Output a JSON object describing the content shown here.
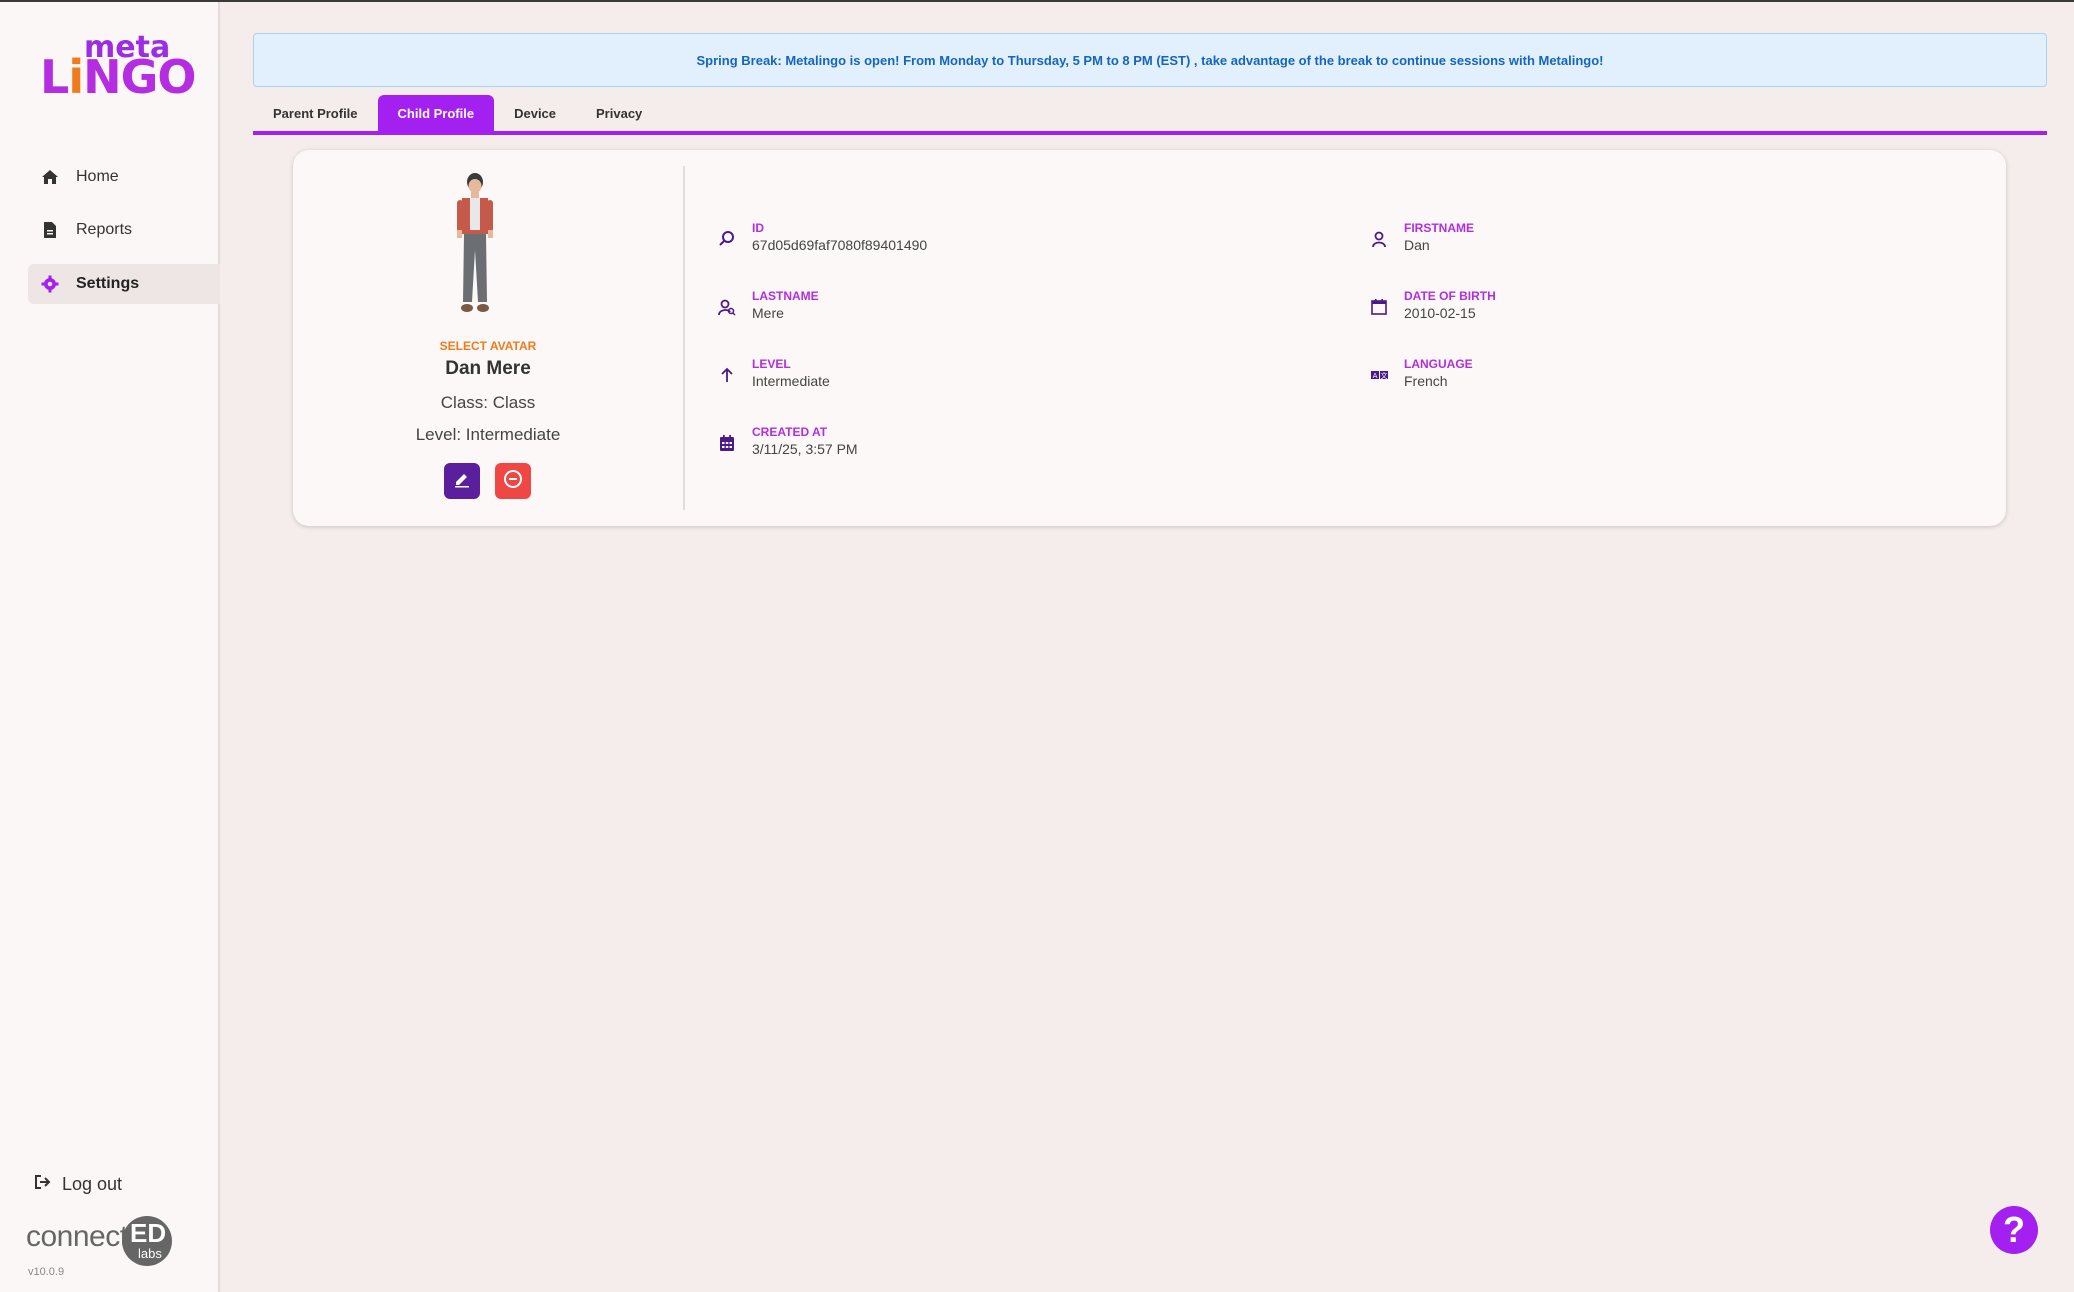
{
  "app": {
    "logo_top": "meta",
    "logo_main": [
      "L",
      "i",
      "N",
      "G",
      "O"
    ],
    "version": "v10.0.9",
    "brand_color": "#a420f0"
  },
  "sidebar": {
    "items": [
      {
        "label": "Home",
        "icon": "home-icon"
      },
      {
        "label": "Reports",
        "icon": "report-icon"
      },
      {
        "label": "Settings",
        "icon": "gear-icon",
        "active": true
      }
    ],
    "logout_label": "Log out",
    "footer_logo": {
      "text": "connect",
      "badge": "ED",
      "sub": "labs"
    }
  },
  "banner": {
    "text": "Spring Break: Metalingo is open! From Monday to Thursday, 5 PM to 8 PM (EST) , take advantage of the break to continue sessions with Metalingo!"
  },
  "tabs": [
    {
      "label": "Parent Profile"
    },
    {
      "label": "Child Profile",
      "active": true
    },
    {
      "label": "Device"
    },
    {
      "label": "Privacy"
    }
  ],
  "profile": {
    "select_avatar_label": "SELECT AVATAR",
    "name": "Dan Mere",
    "class_text": "Class: Class",
    "level_text": "Level: Intermediate"
  },
  "fields": {
    "id": {
      "label": "ID",
      "value": "67d05d69faf7080f89401490",
      "icon": "search-icon"
    },
    "firstname": {
      "label": "FIRSTNAME",
      "value": "Dan",
      "icon": "person-icon"
    },
    "lastname": {
      "label": "LASTNAME",
      "value": "Mere",
      "icon": "person-search-icon"
    },
    "dob": {
      "label": "DATE OF BIRTH",
      "value": "2010-02-15",
      "icon": "calendar-outline-icon"
    },
    "level": {
      "label": "LEVEL",
      "value": "Intermediate",
      "icon": "arrow-up-icon"
    },
    "language": {
      "label": "LANGUAGE",
      "value": "French",
      "icon": "translate-icon"
    },
    "created_at": {
      "label": "CREATED AT",
      "value": "3/11/25, 3:57 PM",
      "icon": "calendar-filled-icon"
    }
  },
  "help_label": "?"
}
